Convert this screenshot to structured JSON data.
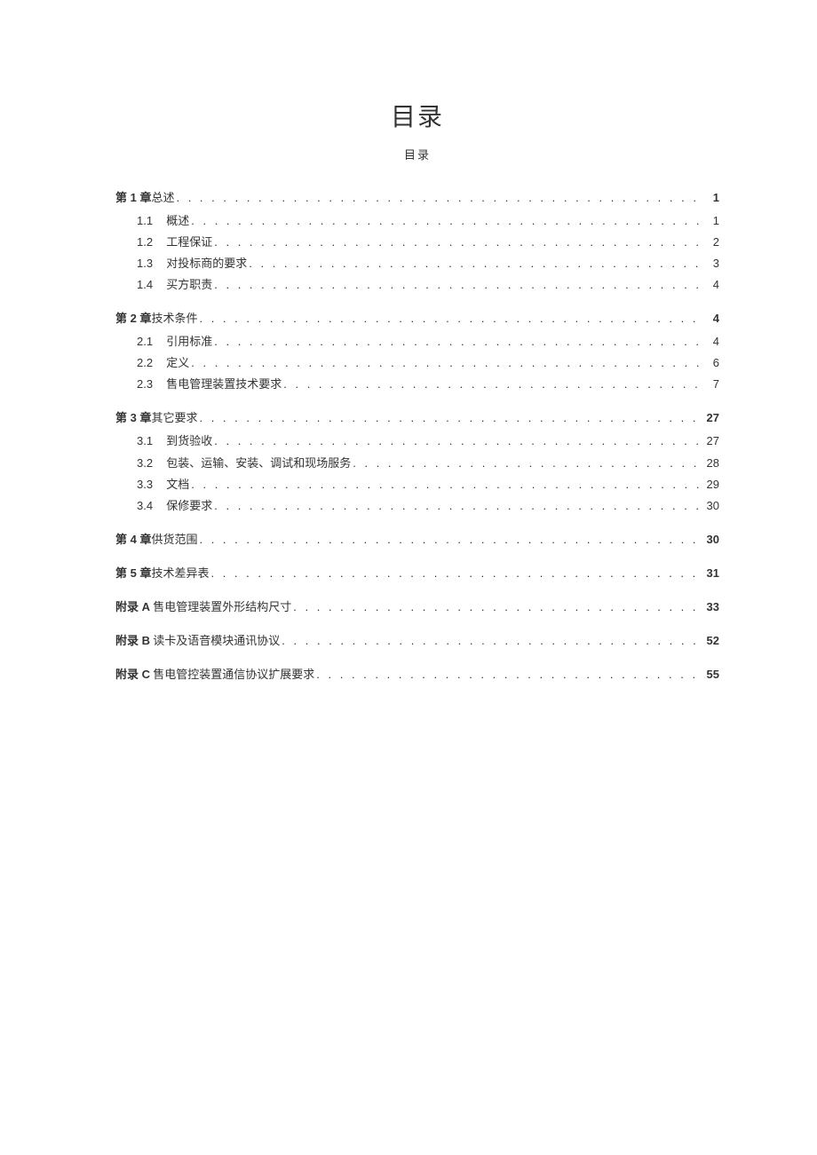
{
  "title": "目录",
  "subtitle": "目录",
  "toc": [
    {
      "type": "chapter",
      "prefix": "第 1 章",
      "label": "总述",
      "page": "1",
      "boldPage": true
    },
    {
      "type": "sub",
      "num": "1.1",
      "label": "概述",
      "page": "1"
    },
    {
      "type": "sub",
      "num": "1.2",
      "label": "工程保证",
      "page": "2"
    },
    {
      "type": "sub",
      "num": "1.3",
      "label": "对投标商的要求",
      "page": "3"
    },
    {
      "type": "sub",
      "num": "1.4",
      "label": "买方职责",
      "page": "4"
    },
    {
      "type": "chapter",
      "prefix": "第 2 章",
      "label": "技术条件",
      "page": "4",
      "boldPage": true
    },
    {
      "type": "sub",
      "num": "2.1",
      "label": "引用标准",
      "page": "4"
    },
    {
      "type": "sub",
      "num": "2.2",
      "label": "定义",
      "page": "6"
    },
    {
      "type": "sub",
      "num": "2.3",
      "label": "售电管理装置技术要求",
      "page": "7"
    },
    {
      "type": "chapter",
      "prefix": "第 3 章",
      "label": "其它要求",
      "page": "27",
      "boldPage": true
    },
    {
      "type": "sub",
      "num": "3.1",
      "label": "到货验收",
      "page": "27"
    },
    {
      "type": "sub",
      "num": "3.2",
      "label": "包装、运输、安装、调试和现场服务",
      "page": "28"
    },
    {
      "type": "sub",
      "num": "3.3",
      "label": "文档",
      "page": "29"
    },
    {
      "type": "sub",
      "num": "3.4",
      "label": "保修要求",
      "page": "30"
    },
    {
      "type": "chapter",
      "prefix": "第 4 章",
      "label": "供货范围",
      "page": "30",
      "boldPage": true
    },
    {
      "type": "chapter",
      "prefix": "第 5 章",
      "label": "技术差异表",
      "page": "31",
      "boldPage": true,
      "gap": true
    },
    {
      "type": "chapter",
      "prefix": "附录 A",
      "label": " 售电管理装置外形结构尺寸",
      "page": "33",
      "boldPage": true,
      "gap": true
    },
    {
      "type": "chapter",
      "prefix": "附录 B",
      "label": " 读卡及语音模块通讯协议",
      "page": "52",
      "boldPage": true,
      "gap": true
    },
    {
      "type": "chapter",
      "prefix": "附录 C",
      "label": " 售电管控装置通信协议扩展要求",
      "page": "55",
      "boldPage": true,
      "gap": true
    }
  ]
}
